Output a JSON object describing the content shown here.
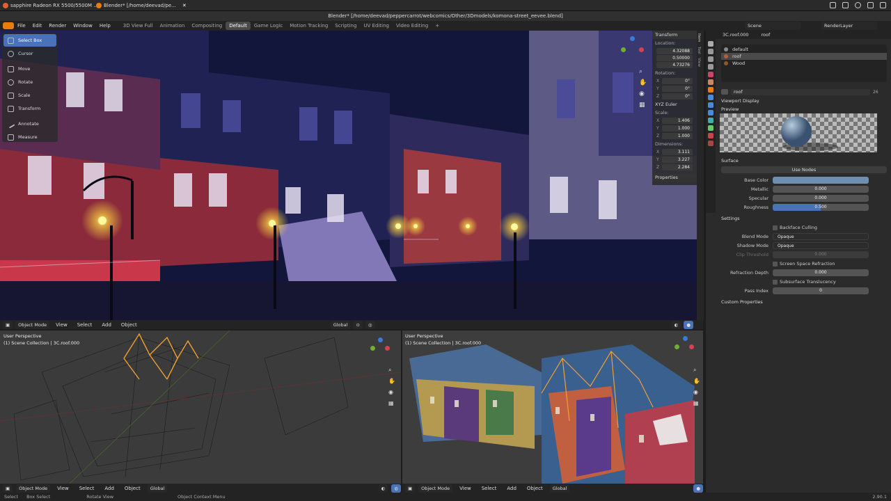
{
  "os": {
    "tabs": [
      "sapphire Radeon RX 5500/5500M ...",
      "Blender* [/home/deevad/pe..."
    ],
    "time": ""
  },
  "window": {
    "title": "Blender* [/home/deevad/peppercarrot/webcomics/Other/3Dmodels/komona-street_eevee.blend]"
  },
  "menu": [
    "File",
    "Edit",
    "Render",
    "Window",
    "Help"
  ],
  "workspaces": [
    "3D View Full",
    "Animation",
    "Compositing",
    "Default",
    "Game Logic",
    "Motion Tracking",
    "Scripting",
    "UV Editing",
    "Video Editing"
  ],
  "active_workspace": "Default",
  "scene": {
    "label": "Scene",
    "view_layer": "RenderLayer"
  },
  "toolbar": {
    "tools": [
      "Select Box",
      "Cursor",
      "Move",
      "Rotate",
      "Scale",
      "Transform",
      "Annotate",
      "Measure"
    ],
    "active": "Select Box"
  },
  "npanel": {
    "title": "Transform",
    "location_label": "Location:",
    "location": [
      "4.32088",
      "0.50000",
      "4.73276"
    ],
    "rotation_label": "Rotation:",
    "rotation": [
      "0°",
      "0°",
      "0°"
    ],
    "rotation_mode": "XYZ Euler",
    "scale_label": "Scale:",
    "scale": [
      "1.406",
      "1.000",
      "1.000"
    ],
    "dimensions_label": "Dimensions:",
    "dimensions": [
      "3.111",
      "3.227",
      "2.284"
    ],
    "axes": [
      "X",
      "Y",
      "Z"
    ],
    "properties": "Properties",
    "side_tabs": [
      "Item",
      "Tool",
      "View"
    ]
  },
  "header": {
    "mode": "Object Mode",
    "menus": [
      "View",
      "Select",
      "Add",
      "Object"
    ],
    "orientation": "Global"
  },
  "viewports": {
    "wire": {
      "label": "User Perspective",
      "collection": "(1) Scene Collection | 3C.roof.000"
    },
    "solid": {
      "label": "User Perspective",
      "collection": "(1) Scene Collection | 3C.roof.000"
    }
  },
  "status": {
    "items": [
      "Select",
      "Box Select",
      "Rotate View",
      "Object Context Menu"
    ],
    "version": "2.90.1"
  },
  "properties": {
    "object": "3C.roof.000",
    "material": "roof",
    "slots": [
      {
        "name": "default",
        "color": "#8a8a8a"
      },
      {
        "name": "roof",
        "color": "#b06040"
      },
      {
        "name": "Wood",
        "color": "#8a5a30"
      }
    ],
    "material_field": "roof",
    "users": "26",
    "viewport_display": "Viewport Display",
    "preview": "Preview",
    "surface": "Surface",
    "use_nodes": "Use Nodes",
    "base_color_label": "Base Color",
    "base_color": "#6f8fb2",
    "metallic_label": "Metallic",
    "metallic": "0.000",
    "specular_label": "Specular",
    "specular": "0.000",
    "roughness_label": "Roughness",
    "roughness": "0.500",
    "settings": "Settings",
    "backface": "Backface Culling",
    "blend_label": "Blend Mode",
    "blend": "Opaque",
    "shadow_label": "Shadow Mode",
    "shadow": "Opaque",
    "clip_label": "Clip Threshold",
    "clip": "0.000",
    "ssr": "Screen Space Refraction",
    "refr_label": "Refraction Depth",
    "refr": "0.000",
    "sss": "Subsurface Translucency",
    "pass_label": "Pass Index",
    "pass": "0",
    "custom": "Custom Properties"
  },
  "colors": {
    "accent": "#4a72b8",
    "selected_outline": "#f0a030"
  }
}
